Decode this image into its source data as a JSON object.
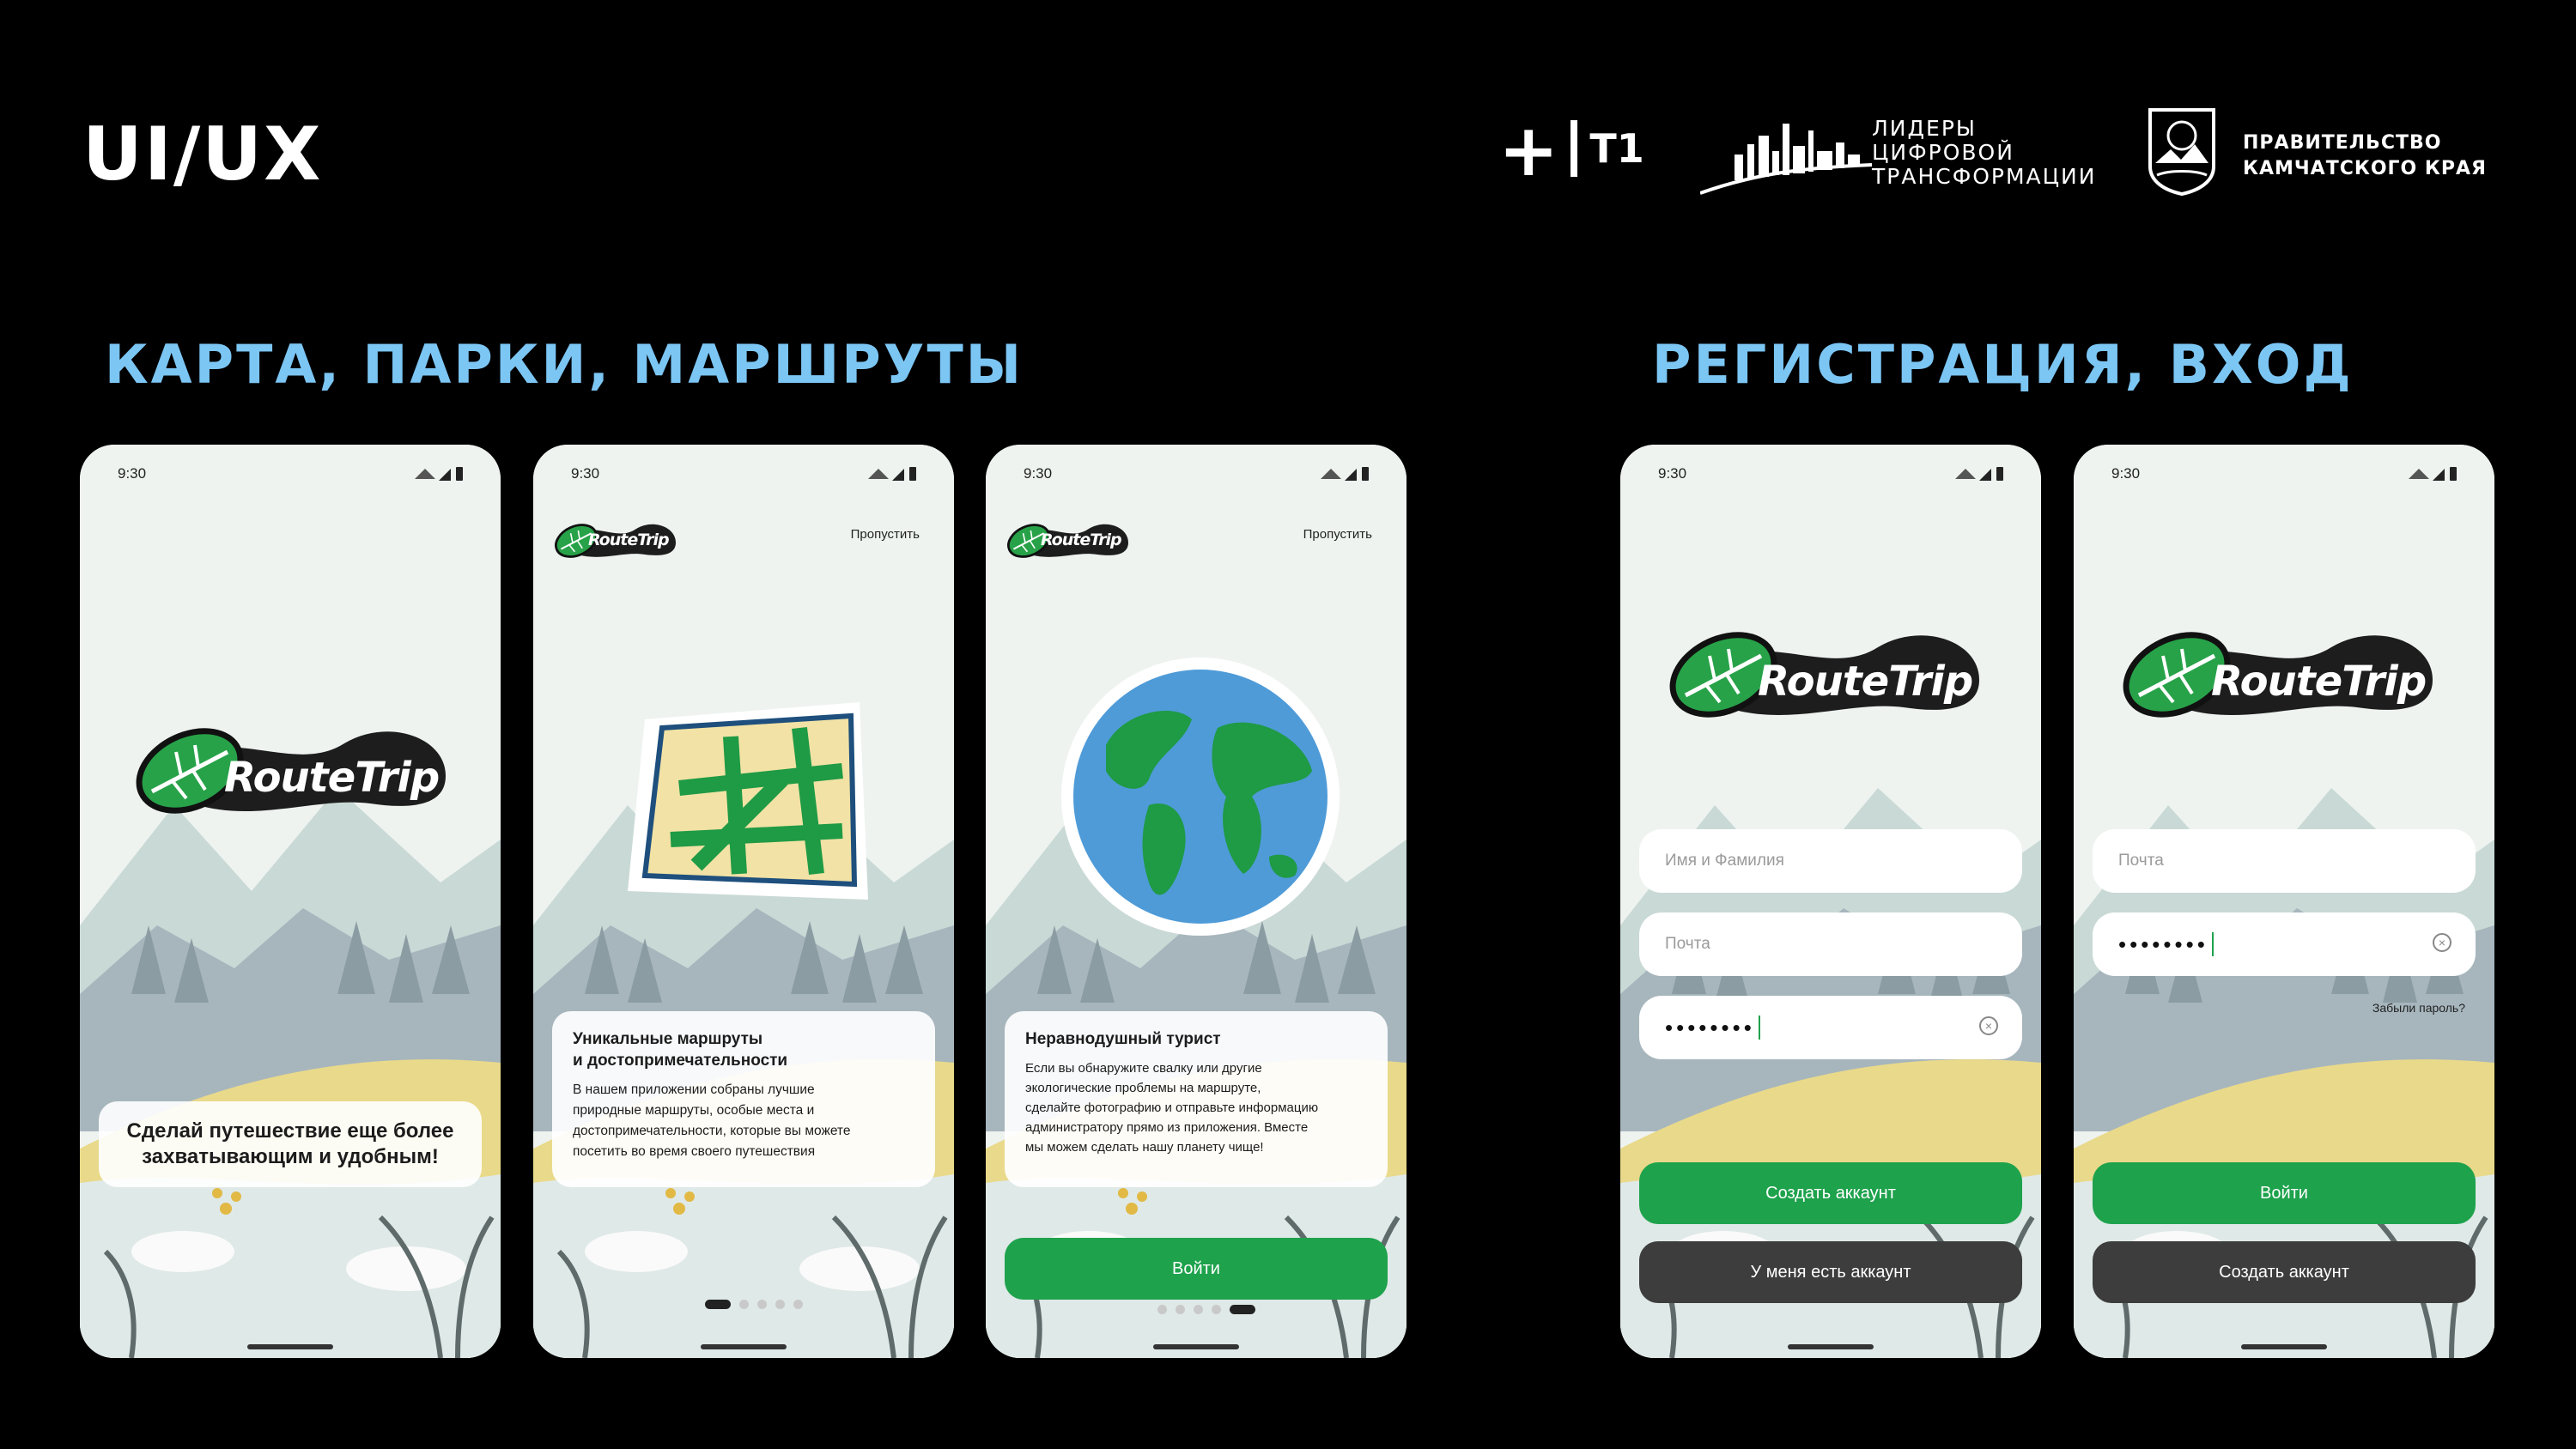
{
  "header": {
    "title": "UI/UX",
    "partner_t1": "T1",
    "leaders_lines": [
      "ЛИДЕРЫ",
      "ЦИФРОВОЙ",
      "ТРАНСФОРМАЦИИ"
    ],
    "gov_lines": [
      "ПРАВИТЕЛЬСТВО",
      "КАМЧАТСКОГО КРАЯ"
    ]
  },
  "sections": {
    "left_title": "КАРТА, ПАРКИ, МАРШРУТЫ",
    "right_title": "РЕГИСТРАЦИЯ, ВХОД"
  },
  "app": {
    "logo_text": "RouteTrip",
    "status_time": "9:30",
    "skip_label": "Пропустить",
    "colors": {
      "accent": "#1ea24c",
      "dark_button": "#3d3d3d",
      "sky": "#eef3f0"
    }
  },
  "screens": {
    "splash": {
      "tagline": "Сделай путешествие еще более захватывающим и удобным!"
    },
    "onboarding1": {
      "card_title": "Уникальные маршруты\nи достопримечательности",
      "card_body": "В нашем приложении собраны лучшие\nприродные маршруты, особые места и\nдостопримечательности, которые вы можете\nпосетить во время своего путешествия",
      "page_index": 1,
      "page_count": 5
    },
    "onboarding2": {
      "card_title": "Неравнодушный турист",
      "card_body": "Если вы обнаружите свалку или другие\nэкологические проблемы на маршруте,\nсделайте фотографию и отправьте информацию\nадминистратору прямо из приложения. Вместе\nмы можем сделать нашу планету чище!",
      "button_label": "Войти",
      "page_index": 5,
      "page_count": 5
    },
    "register": {
      "name_placeholder": "Имя и Фамилия",
      "email_placeholder": "Почта",
      "password_value": "••••••••",
      "create_label": "Создать аккаунт",
      "have_account_label": "У меня есть аккаунт"
    },
    "login": {
      "email_placeholder": "Почта",
      "password_value": "••••••••",
      "forgot_label": "Забыли пароль?",
      "login_label": "Войти",
      "create_label": "Создать аккаунт"
    }
  }
}
